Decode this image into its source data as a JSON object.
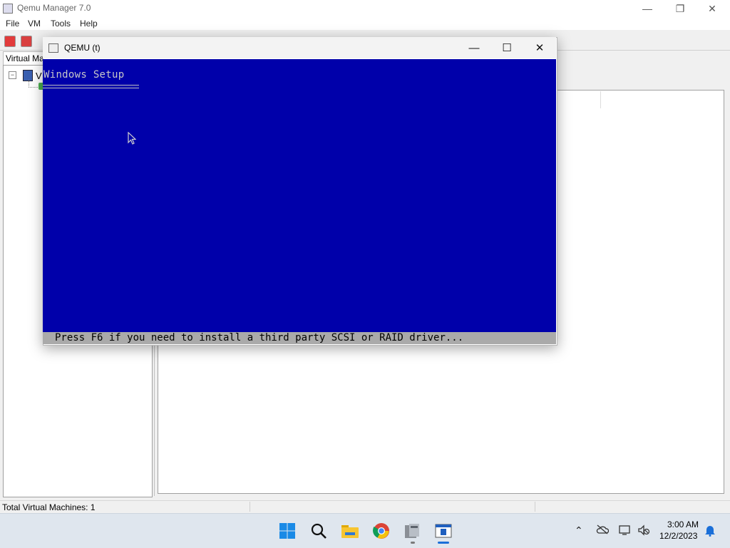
{
  "manager": {
    "title": "Qemu Manager 7.0",
    "menu": [
      "File",
      "VM",
      "Tools",
      "Help"
    ],
    "left_tab": "Virtual Machines",
    "tree_root_label": "V",
    "status": "Total Virtual Machines: 1"
  },
  "qemu_window": {
    "title": "QEMU (t)",
    "screen_bg": "#0000aa",
    "setup_title": "Windows Setup",
    "setup_status": "Press F6 if you need to install a third party SCSI or RAID driver..."
  },
  "taskbar": {
    "icons": [
      "windows-start-icon",
      "search-icon",
      "file-explorer-icon",
      "chrome-icon",
      "qemu-manager-icon",
      "qemu-window-icon"
    ],
    "time": "3:00 AM",
    "date": "12/2/2023"
  }
}
